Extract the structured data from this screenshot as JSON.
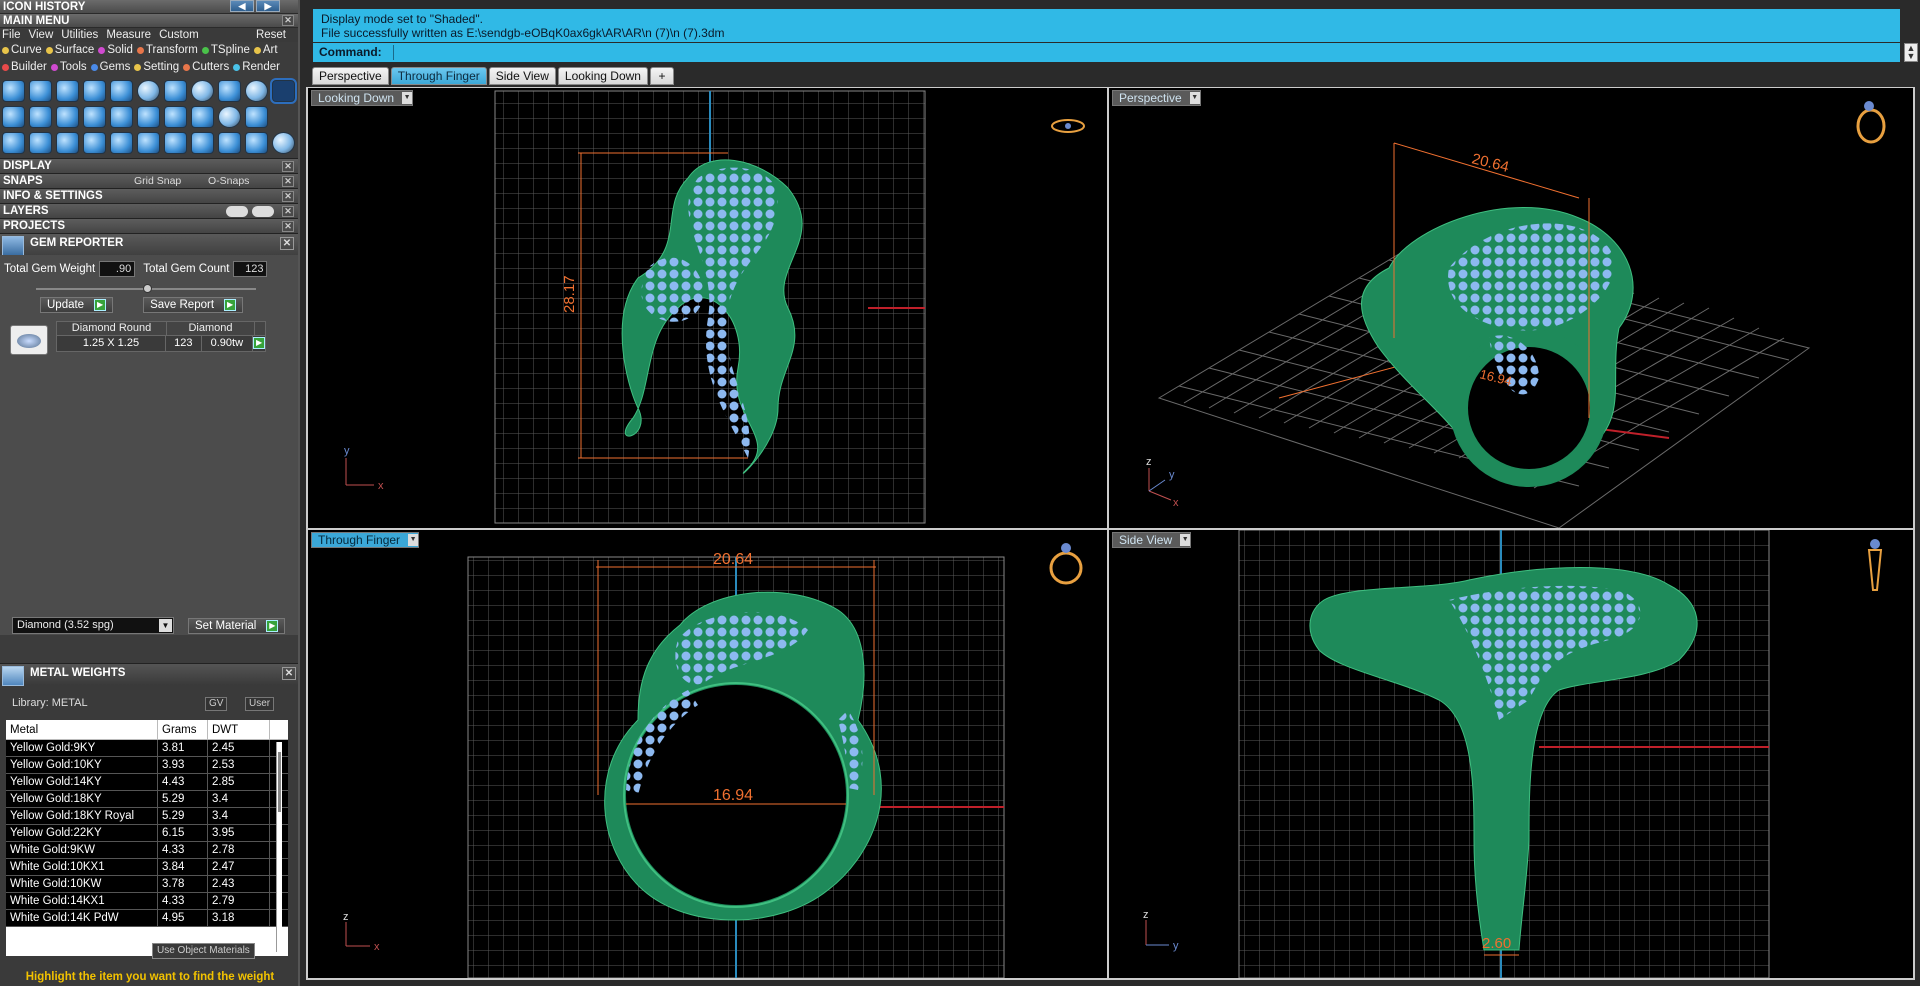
{
  "left": {
    "icon_history": "ICON HISTORY",
    "main_menu": "MAIN MENU",
    "menu": [
      "File",
      "View",
      "Utilities",
      "Measure",
      "Custom"
    ],
    "reset": "Reset",
    "categories_row1": [
      {
        "label": "Curve",
        "color": "#e8c44a"
      },
      {
        "label": "Surface",
        "color": "#e8c44a"
      },
      {
        "label": "Solid",
        "color": "#d04ad0"
      },
      {
        "label": "Transform",
        "color": "#e8764a"
      },
      {
        "label": "TSpline",
        "color": "#4ac24a"
      },
      {
        "label": "Art",
        "color": "#e8c44a"
      }
    ],
    "categories_row2": [
      {
        "label": "Builder",
        "color": "#e84a4a"
      },
      {
        "label": "Tools",
        "color": "#d04ad0"
      },
      {
        "label": "Gems",
        "color": "#4a8ae8"
      },
      {
        "label": "Setting",
        "color": "#e8c44a"
      },
      {
        "label": "Cutters",
        "color": "#e8764a"
      },
      {
        "label": "Render",
        "color": "#4ac2e8"
      }
    ],
    "sections": {
      "display": "DISPLAY",
      "snaps": "SNAPS",
      "grid_snap": "Grid Snap",
      "o_snaps": "O-Snaps",
      "info": "INFO & SETTINGS",
      "layers": "LAYERS",
      "projects": "PROJECTS"
    },
    "gem_reporter": {
      "title": "GEM REPORTER",
      "total_weight_label": "Total Gem Weight",
      "total_weight_value": ".90",
      "total_count_label": "Total Gem Count",
      "total_count_value": "123",
      "update": "Update",
      "save_report": "Save Report",
      "col_shape": "Diamond Round",
      "col_material": "Diamond",
      "row_size": "1.25 X 1.25",
      "row_count": "123",
      "row_weight": "0.90tw",
      "material_select": "Diamond     (3.52 spg)",
      "set_material": "Set Material"
    },
    "metal_weights": {
      "title": "METAL WEIGHTS",
      "library": "Library: METAL",
      "gv": "GV",
      "user": "User",
      "headers": [
        "Metal",
        "Grams",
        "DWT"
      ],
      "rows": [
        [
          "Yellow Gold:9KY",
          "3.81",
          "2.45"
        ],
        [
          "Yellow Gold:10KY",
          "3.93",
          "2.53"
        ],
        [
          "Yellow Gold:14KY",
          "4.43",
          "2.85"
        ],
        [
          "Yellow Gold:18KY",
          "5.29",
          "3.4"
        ],
        [
          "Yellow Gold:18KY Royal",
          "5.29",
          "3.4"
        ],
        [
          "Yellow Gold:22KY",
          "6.15",
          "3.95"
        ],
        [
          "White Gold:9KW",
          "4.33",
          "2.78"
        ],
        [
          "White Gold:10KX1",
          "3.84",
          "2.47"
        ],
        [
          "White Gold:10KW",
          "3.78",
          "2.43"
        ],
        [
          "White Gold:14KX1",
          "4.33",
          "2.79"
        ],
        [
          "White Gold:14K PdW",
          "4.95",
          "3.18"
        ]
      ],
      "use_object_materials": "Use Object Materials",
      "hint": "Highlight the item you want to find the weight"
    }
  },
  "command": {
    "line1": "Display mode set to \"Shaded\".",
    "line2": "File successfully written as E:\\sendgb-eOBqK0ax6gk\\AR\\AR\\n (7)\\n (7).3dm",
    "label": "Command:"
  },
  "tabs": [
    "Perspective",
    "Through Finger",
    "Side View",
    "Looking Down",
    "+"
  ],
  "viewports": {
    "top_left": {
      "label": "Looking Down",
      "dim": "28.17"
    },
    "top_right": {
      "label": "Perspective",
      "dim1": "20.64",
      "dim2": "16.94"
    },
    "bottom_left": {
      "label": "Through Finger",
      "dim1": "20.64",
      "dim2": "16.94"
    },
    "bottom_right": {
      "label": "Side View",
      "dim": "2.60"
    }
  },
  "colors": {
    "cmd_bg": "#30b9e6",
    "ring_green": "#1e8a5a",
    "gem_blue": "#8db9f0",
    "dim_orange": "#f07030",
    "axis_red": "#c0202a",
    "hint_yellow": "#f2c200"
  }
}
